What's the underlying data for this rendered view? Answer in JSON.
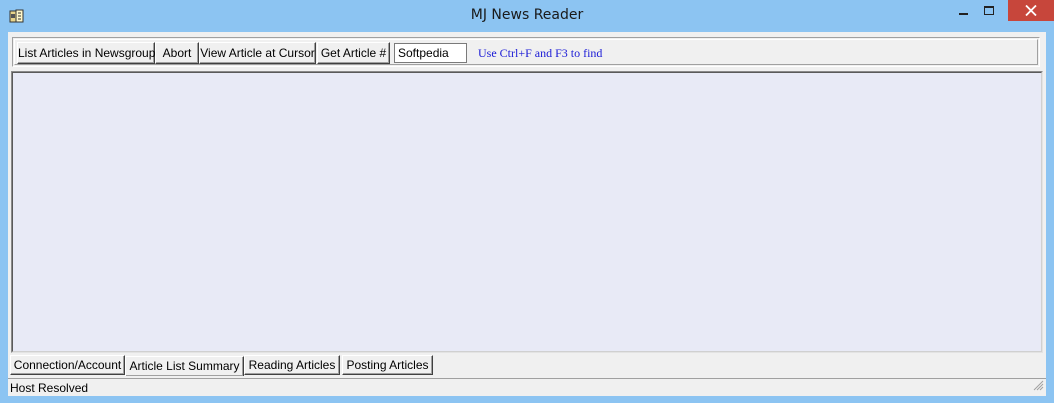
{
  "window": {
    "title": "MJ News Reader",
    "accent_color": "#8cc4f2",
    "close_color": "#c7463b",
    "app_icon": "newspaper-icon"
  },
  "toolbar": {
    "list_articles_label": "List Articles in Newsgroup",
    "abort_label": "Abort",
    "view_article_label": "View Article at Cursor",
    "get_article_label": "Get Article #",
    "search_value": "Softpedia",
    "hint": "Use Ctrl+F and F3 to find"
  },
  "tabs": [
    {
      "label": "Connection/Account"
    },
    {
      "label": "Article List Summary",
      "active": true
    },
    {
      "label": "Reading Articles"
    },
    {
      "label": "Posting Articles"
    }
  ],
  "status": {
    "text": "Host Resolved"
  }
}
